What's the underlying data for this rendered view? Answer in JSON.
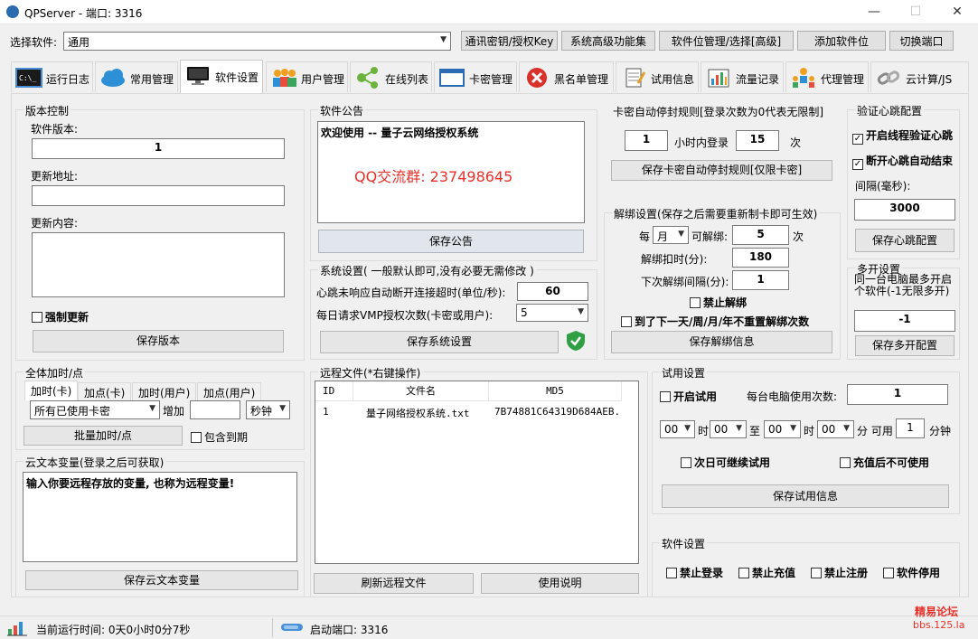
{
  "window": {
    "title": "QPServer - 端口: 3316",
    "minimize": "—",
    "maximize": "☐",
    "close": "✕"
  },
  "topbar": {
    "select_label": "选择软件:",
    "software_value": "通用",
    "buttons": [
      "通讯密钥/授权Key",
      "系统高级功能集",
      "软件位管理/选择[高级]",
      "添加软件位",
      "切换端口"
    ]
  },
  "tabs": [
    {
      "label": "运行日志",
      "icon": "terminal-icon"
    },
    {
      "label": "常用管理",
      "icon": "cloud-icon"
    },
    {
      "label": "软件设置",
      "icon": "monitor-icon"
    },
    {
      "label": "用户管理",
      "icon": "users-icon"
    },
    {
      "label": "在线列表",
      "icon": "network-icon"
    },
    {
      "label": "卡密管理",
      "icon": "window-icon"
    },
    {
      "label": "黑名单管理",
      "icon": "block-icon"
    },
    {
      "label": "试用信息",
      "icon": "notepad-icon"
    },
    {
      "label": "流量记录",
      "icon": "bar-chart-icon"
    },
    {
      "label": "代理管理",
      "icon": "agents-icon"
    },
    {
      "label": "云计算/JS",
      "icon": "link-icon"
    }
  ],
  "version": {
    "group": "版本控制",
    "version_label": "软件版本:",
    "version_value": "1",
    "url_label": "更新地址:",
    "url_value": "",
    "content_label": "更新内容:",
    "content_value": "",
    "force_update": "强制更新",
    "save": "保存版本"
  },
  "notice": {
    "group": "软件公告",
    "text": "欢迎使用 -- 量子云网络授权系统",
    "qq": "QQ交流群: 237498645",
    "save": "保存公告"
  },
  "system": {
    "group": "系统设置( 一般默认即可,没有必要无需修改 )",
    "timeout_label": "心跳未响应自动断开连接超时(单位/秒):",
    "timeout_value": "60",
    "vmp_label": "每日请求VMP授权次数(卡密或用户):",
    "vmp_value": "5",
    "save": "保存系统设置"
  },
  "card_stop": {
    "group": "卡密自动停封规则[登录次数为0代表无限制]",
    "hours_value": "1",
    "hours_label": "小时内登录",
    "times_value": "15",
    "times_label": "次",
    "save": "保存卡密自动停封规则[仅限卡密]"
  },
  "heartbeat": {
    "group": "验证心跳配置",
    "thread_check": "开启线程验证心跳",
    "auto_end": "断开心跳自动结束",
    "interval_label": "间隔(毫秒):",
    "interval_value": "3000",
    "save": "保存心跳配置"
  },
  "unbind": {
    "group": "解绑设置(保存之后需要重新制卡即可生效)",
    "per_label": "每",
    "period_value": "月",
    "can_unbind_label": "可解绑:",
    "can_unbind_value": "5",
    "times_label": "次",
    "deduct_label": "解绑扣时(分):",
    "deduct_value": "180",
    "interval_label": "下次解绑间隔(分):",
    "interval_value": "1",
    "forbid": "禁止解绑",
    "no_reset": "到了下一天/周/月/年不重置解绑次数",
    "save": "保存解绑信息"
  },
  "multi": {
    "group": "多开设置",
    "desc": "同一台电脑最多开启个软件(-1无限多开)",
    "value": "-1",
    "save": "保存多开配置"
  },
  "global_add": {
    "group": "全体加时/点",
    "subtabs": [
      "加时(卡)",
      "加点(卡)",
      "加时(用户)",
      "加点(用户)"
    ],
    "target_value": "所有已使用卡密",
    "add_label": "增加",
    "amount_value": "",
    "unit_value": "秒钟",
    "batch": "批量加时/点",
    "include_expired": "包含到期"
  },
  "cloud_text": {
    "group": "云文本变量(登录之后可获取)",
    "value": "输入你要远程存放的变量, 也称为远程变量!",
    "save": "保存云文本变量"
  },
  "remote_files": {
    "group": "远程文件(*右键操作)",
    "columns": [
      "ID",
      "文件名",
      "MD5"
    ],
    "rows": [
      [
        "1",
        "量子网络授权系统.txt",
        "7B74881C64319D684AEB..."
      ]
    ],
    "refresh": "刷新远程文件",
    "help": "使用说明"
  },
  "trial": {
    "group": "试用设置",
    "enable": "开启试用",
    "per_pc_label": "每台电脑使用次数:",
    "per_pc_value": "1",
    "h1": "00",
    "m1": "00",
    "h2": "00",
    "m2": "00",
    "hour": "时",
    "to": "至",
    "minute_can": "分 可用",
    "minutes_value": "1",
    "minute_unit": "分钟",
    "next_day": "次日可继续试用",
    "no_after_recharge": "充值后不可使用",
    "save": "保存试用信息"
  },
  "software_settings": {
    "group": "软件设置",
    "options": [
      "禁止登录",
      "禁止充值",
      "禁止注册",
      "软件停用"
    ]
  },
  "status": {
    "runtime": "当前运行时间: 0天0小时0分7秒",
    "port": "启动端口: 3316"
  },
  "watermark": {
    "line1": "精易论坛",
    "line2": "bbs.125.la"
  },
  "colors": {
    "qq_red": "#e8302a",
    "accent": "#0078d7",
    "shield_green": "#2ea043"
  }
}
